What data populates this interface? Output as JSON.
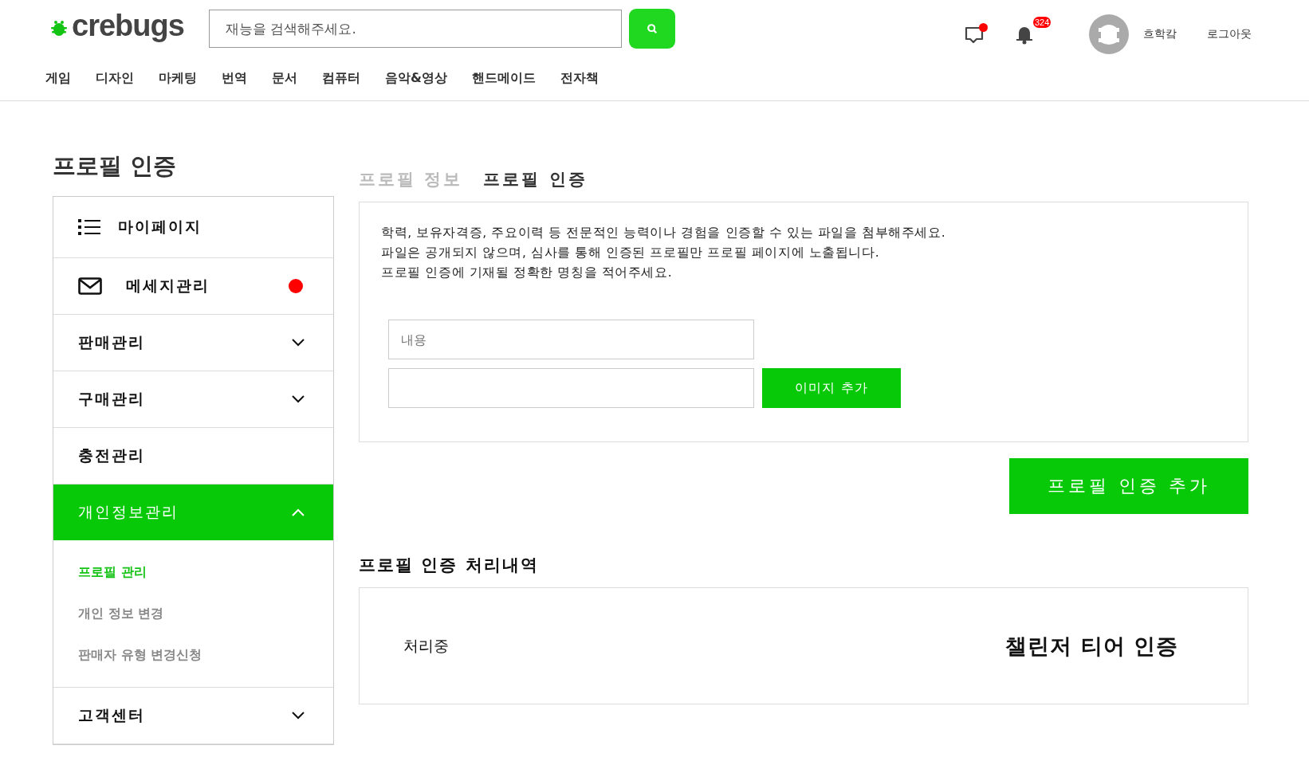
{
  "header": {
    "logo": "crebugs",
    "search": {
      "placeholder": "재능을 검색해주세요."
    },
    "categories": [
      "게임",
      "디자인",
      "마케팅",
      "번역",
      "문서",
      "컴퓨터",
      "음악&영상",
      "핸드메이드",
      "전자책"
    ],
    "messages": {
      "unread": true
    },
    "notifications": {
      "count": "324"
    },
    "user": {
      "name": "흐학캌"
    },
    "logout": "로그아웃"
  },
  "page_title": "프로필 인증",
  "sidebar": {
    "items": [
      {
        "kind": "home",
        "label": "마이페이지"
      },
      {
        "kind": "inbox",
        "label": "메세지관리",
        "unread": true
      },
      {
        "kind": "menu",
        "label": "판매관리",
        "expanded": false,
        "selected": false
      },
      {
        "kind": "menu",
        "label": "구매관리",
        "expanded": false,
        "selected": false
      },
      {
        "kind": "plain",
        "label": "충전관리",
        "selected": false
      },
      {
        "kind": "menu",
        "label": "개인정보관리",
        "expanded": true,
        "selected": true,
        "children": [
          {
            "label": "프로필 관리",
            "selected": true
          },
          {
            "label": "개인 정보 변경",
            "selected": false
          },
          {
            "label": "판매자 유형 변경신청",
            "selected": false
          }
        ]
      },
      {
        "kind": "menu",
        "label": "고객센터",
        "expanded": false,
        "selected": false
      }
    ]
  },
  "tabs": [
    {
      "label": "프로필 정보",
      "selected": false
    },
    {
      "label": "프로필 인증",
      "selected": true
    }
  ],
  "form": {
    "instructions": [
      "학력, 보유자격증, 주요이력 등 전문적인 능력이나 경험을 인증할 수 있는 파일을 첨부해주세요.",
      "파일은 공개되지 않으며, 심사를 통해 인증된 프로필만 프로필 페이지에 노출됩니다.",
      "프로필 인증에 기재될 정확한 명칭을 적어주세요."
    ],
    "name_field": {
      "placeholder": "내용"
    },
    "image_button": "이미지 추가"
  },
  "submit_button": "프로필 인증 추가",
  "history": {
    "title": "프로필 인증 처리내역",
    "rows": [
      {
        "status": "처리중",
        "name": "챌린저 티어 인증"
      }
    ]
  }
}
